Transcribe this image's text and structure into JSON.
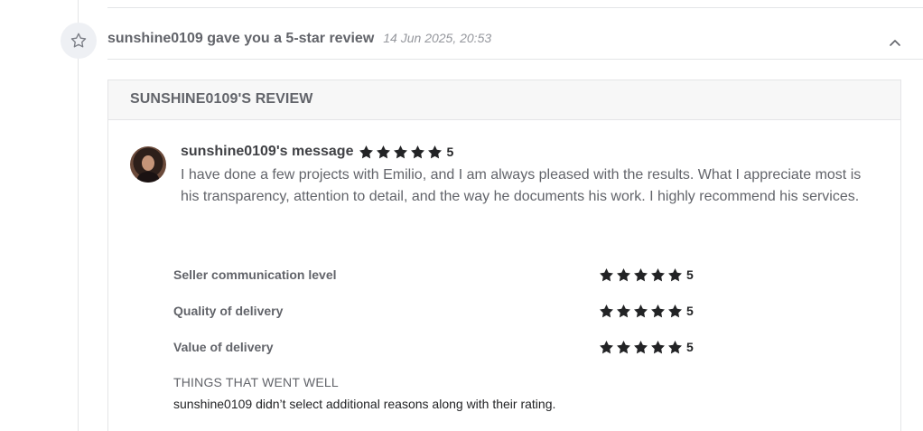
{
  "event": {
    "icon": "star-outline-icon",
    "title": "sunshine0109 gave you a 5-star review",
    "timestamp": "14 Jun 2025, 20:53",
    "collapse_icon": "chevron-up-icon"
  },
  "review": {
    "header": "SUNSHINE0109'S REVIEW",
    "author_heading": "sunshine0109's message",
    "overall_rating": 5,
    "overall_rating_label": "5",
    "message": "I have done a few projects with Emilio, and I am always pleased with the results. What I appreciate most is his transparency, attention to detail, and the way he documents his work. I highly recommend his services.",
    "ratings": [
      {
        "label": "Seller communication level",
        "value": 5,
        "value_label": "5"
      },
      {
        "label": "Quality of delivery",
        "value": 5,
        "value_label": "5"
      },
      {
        "label": "Value of delivery",
        "value": 5,
        "value_label": "5"
      }
    ],
    "went_well_title": "THINGS THAT WENT WELL",
    "went_well_text": "sunshine0109 didn’t select additional reasons along with their rating."
  },
  "colors": {
    "star": "#222325",
    "timeline": "#e4e5e7",
    "icon_circle": "#eef0f4"
  }
}
